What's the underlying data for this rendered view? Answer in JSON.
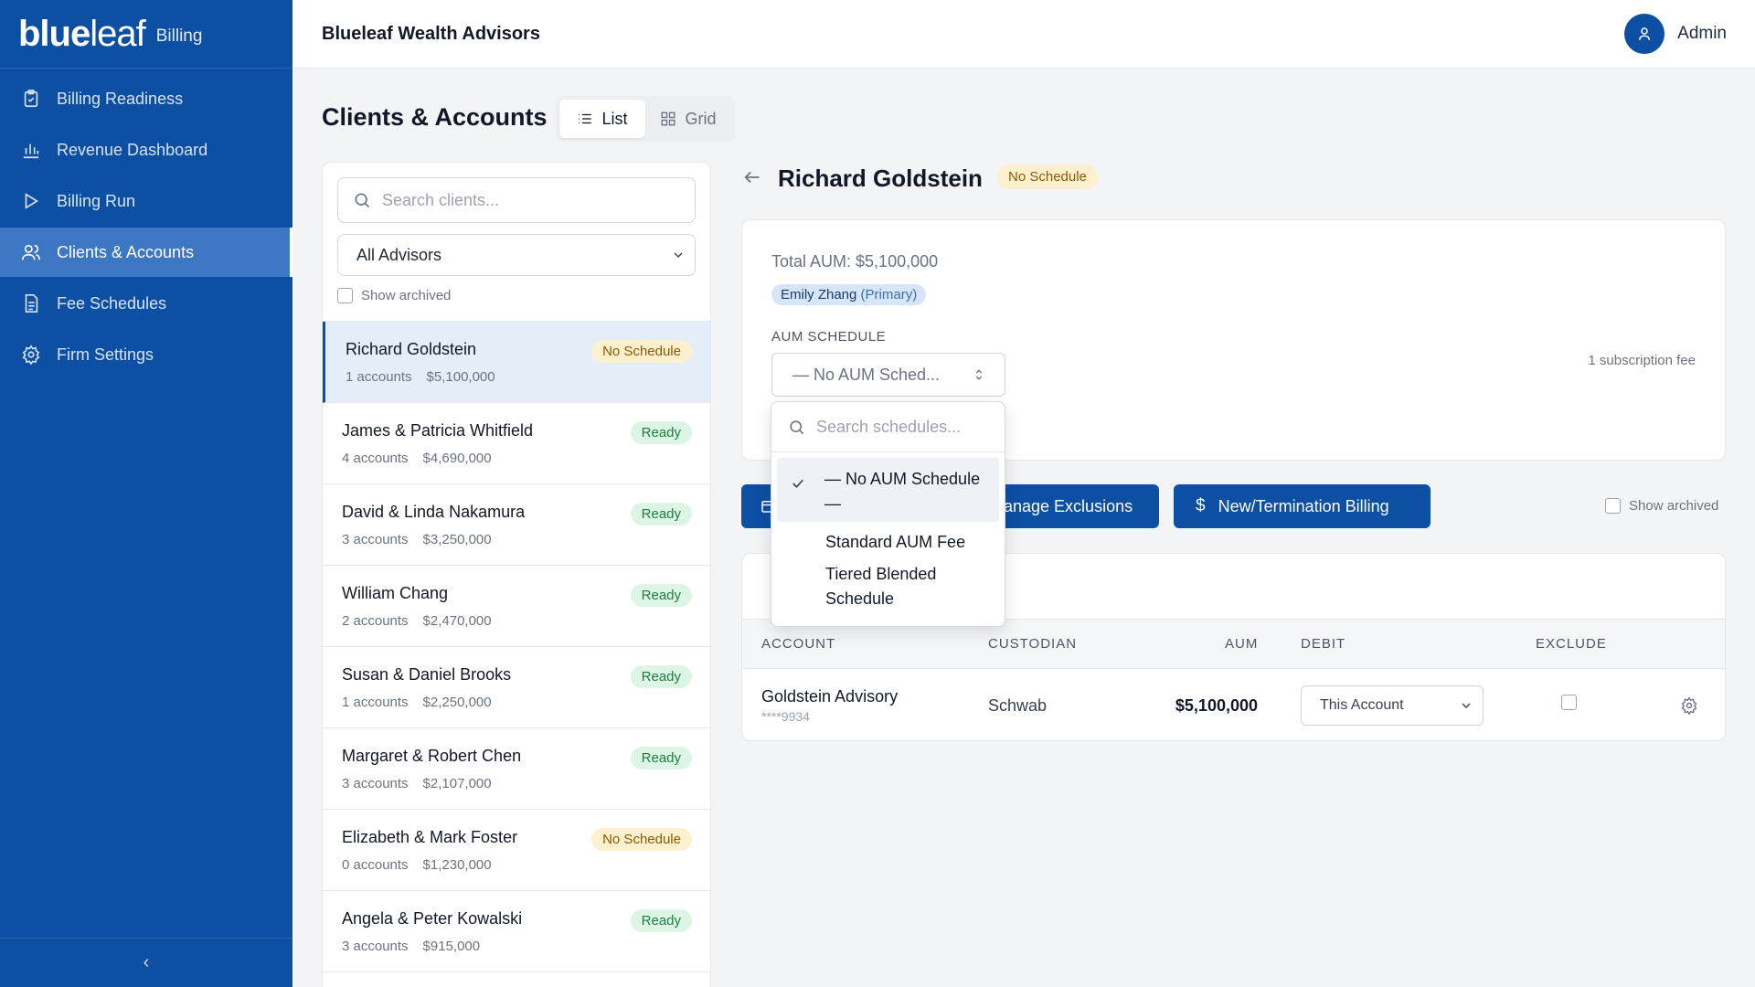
{
  "brand": {
    "logo_bold": "blue",
    "logo_light": "leaf",
    "sub": "Billing"
  },
  "nav": [
    {
      "label": "Billing Readiness",
      "icon": "clipboard-check-icon"
    },
    {
      "label": "Revenue Dashboard",
      "icon": "bar-chart-icon"
    },
    {
      "label": "Billing Run",
      "icon": "play-icon"
    },
    {
      "label": "Clients & Accounts",
      "icon": "users-icon",
      "active": true
    },
    {
      "label": "Fee Schedules",
      "icon": "document-icon"
    },
    {
      "label": "Firm Settings",
      "icon": "gear-icon"
    }
  ],
  "collapse": {
    "glyph": "‹"
  },
  "header": {
    "firm_name": "Blueleaf Wealth Advisors",
    "user_name": "Admin"
  },
  "page": {
    "title": "Clients & Accounts",
    "view_list": "List",
    "view_grid": "Grid"
  },
  "client_panel": {
    "search_placeholder": "Search clients...",
    "advisor_filter": "All Advisors",
    "show_archived": "Show archived",
    "clients": [
      {
        "name": "Richard Goldstein",
        "accounts": "1 accounts",
        "aum": "$5,100,000",
        "status": "No Schedule"
      },
      {
        "name": "James & Patricia Whitfield",
        "accounts": "4 accounts",
        "aum": "$4,690,000",
        "status": "Ready"
      },
      {
        "name": "David & Linda Nakamura",
        "accounts": "3 accounts",
        "aum": "$3,250,000",
        "status": "Ready"
      },
      {
        "name": "William Chang",
        "accounts": "2 accounts",
        "aum": "$2,470,000",
        "status": "Ready"
      },
      {
        "name": "Susan & Daniel Brooks",
        "accounts": "1 accounts",
        "aum": "$2,250,000",
        "status": "Ready"
      },
      {
        "name": "Margaret & Robert Chen",
        "accounts": "3 accounts",
        "aum": "$2,107,000",
        "status": "Ready"
      },
      {
        "name": "Elizabeth & Mark Foster",
        "accounts": "0 accounts",
        "aum": "$1,230,000",
        "status": "No Schedule"
      },
      {
        "name": "Angela & Peter Kowalski",
        "accounts": "3 accounts",
        "aum": "$915,000",
        "status": "Ready"
      }
    ]
  },
  "detail": {
    "name": "Richard Goldstein",
    "status": "No Schedule",
    "total_aum": "Total AUM: $5,100,000",
    "advisor_name": "Emily Zhang",
    "advisor_role": "(Primary)",
    "aum_schedule_label": "AUM SCHEDULE",
    "aum_schedule_value": "— No AUM Sched...",
    "subscription_fee": "1 subscription fee",
    "btn_exclusions": "anage Exclusions",
    "btn_new_billing": "New/Termination Billing",
    "show_archived": "Show archived",
    "table": {
      "headers": {
        "account": "ACCOUNT",
        "custodian": "CUSTODIAN",
        "aum": "AUM",
        "debit": "DEBIT",
        "exclude": "EXCLUDE"
      },
      "rows": [
        {
          "account": "Goldstein Advisory",
          "number": "****9934",
          "custodian": "Schwab",
          "aum": "$5,100,000",
          "debit": "This Account"
        }
      ]
    }
  },
  "dropdown": {
    "search_placeholder": "Search schedules...",
    "options": [
      "— No AUM Schedule —",
      "Standard AUM Fee",
      "Tiered Blended Schedule"
    ],
    "selected": "— No AUM Schedule —"
  },
  "colors": {
    "brand": "#0d4fa3",
    "ready_bg": "#dcf5e4",
    "no_schedule_bg": "#fdf0cf"
  }
}
